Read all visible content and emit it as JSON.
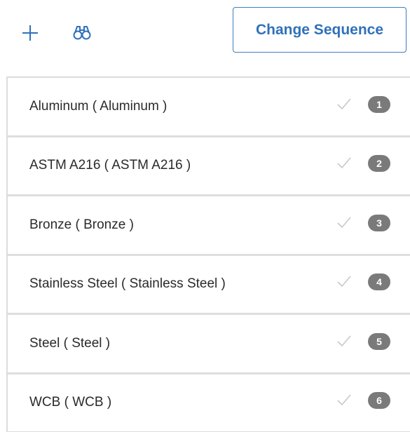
{
  "toolbar": {
    "add_icon": "plus-icon",
    "find_icon": "binoculars-icon",
    "change_sequence_label": "Change Sequence"
  },
  "colors": {
    "accent": "#3071b9",
    "badge": "#7a7a7a",
    "check": "#c8c8c8",
    "divider": "#dedede"
  },
  "items": [
    {
      "label": "Aluminum ( Aluminum )",
      "sequence": "1"
    },
    {
      "label": "ASTM A216 ( ASTM A216 )",
      "sequence": "2"
    },
    {
      "label": "Bronze ( Bronze )",
      "sequence": "3"
    },
    {
      "label": "Stainless Steel ( Stainless Steel )",
      "sequence": "4"
    },
    {
      "label": "Steel ( Steel )",
      "sequence": "5"
    },
    {
      "label": "WCB ( WCB )",
      "sequence": "6"
    }
  ]
}
